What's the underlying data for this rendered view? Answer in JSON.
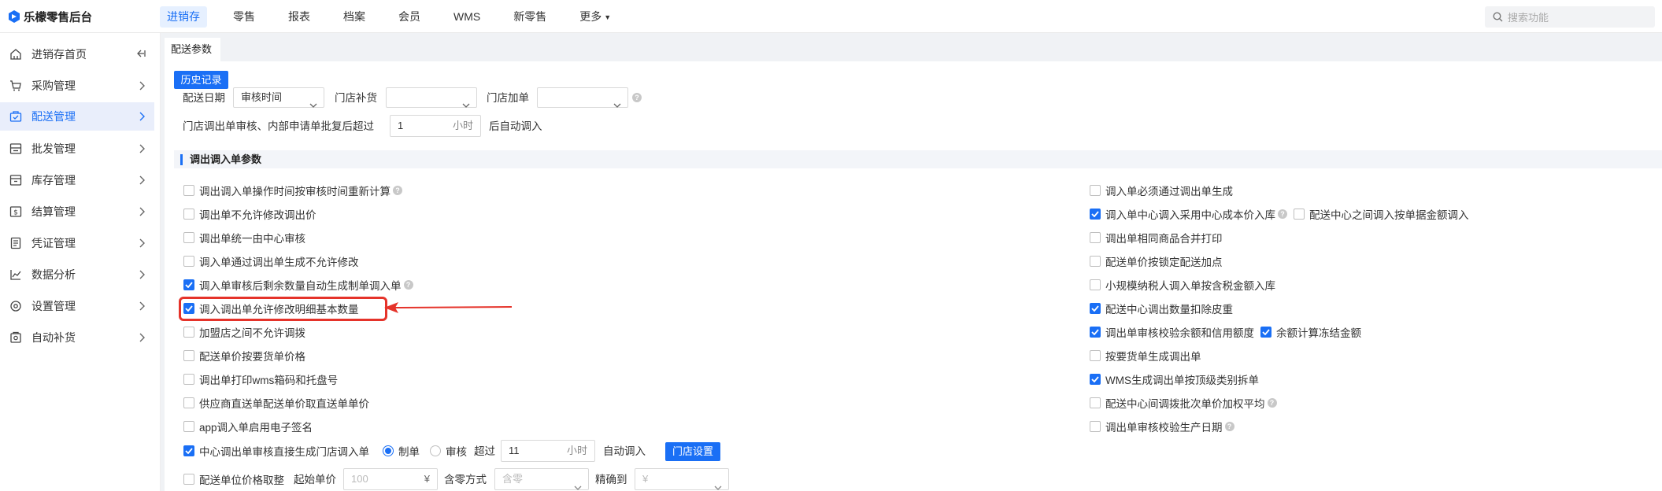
{
  "app": {
    "title": "乐檬零售后台"
  },
  "nav": {
    "items": [
      "进销存",
      "零售",
      "报表",
      "档案",
      "会员",
      "WMS",
      "新零售",
      "更多"
    ],
    "search_placeholder": "搜索功能"
  },
  "sidebar": {
    "items": [
      {
        "label": "进销存首页",
        "icon": "home-icon"
      },
      {
        "label": "采购管理",
        "icon": "cart-icon"
      },
      {
        "label": "配送管理",
        "icon": "delivery-icon"
      },
      {
        "label": "批发管理",
        "icon": "wholesale-icon"
      },
      {
        "label": "库存管理",
        "icon": "inventory-icon"
      },
      {
        "label": "结算管理",
        "icon": "settlement-icon"
      },
      {
        "label": "凭证管理",
        "icon": "voucher-icon"
      },
      {
        "label": "数据分析",
        "icon": "chart-icon"
      },
      {
        "label": "设置管理",
        "icon": "settings-icon"
      },
      {
        "label": "自动补货",
        "icon": "auto-replenish-icon"
      }
    ]
  },
  "page": {
    "tab": "配送参数",
    "history_button": "历史记录",
    "delivery_date_label": "配送日期",
    "delivery_date_value": "审核时间",
    "store_replenish_label": "门店补货",
    "store_replenish_value": "",
    "store_add_label": "门店加单",
    "store_add_value": "",
    "auto_in_prefix": "门店调出单审核、内部申请单批复后超过",
    "auto_in_value": "1",
    "auto_in_unit": "小时",
    "auto_in_suffix": "后自动调入",
    "section_title": "调出调入单参数"
  },
  "left_options": [
    {
      "label": "调出调入单操作时间按审核时间重新计算",
      "checked": false,
      "help": true
    },
    {
      "label": "调出单不允许修改调出价",
      "checked": false,
      "help": false
    },
    {
      "label": "调出单统一由中心审核",
      "checked": false,
      "help": false
    },
    {
      "label": "调入单通过调出单生成不允许修改",
      "checked": false,
      "help": false
    },
    {
      "label": "调入单审核后剩余数量自动生成制单调入单",
      "checked": true,
      "help": true
    },
    {
      "label": "调入调出单允许修改明细基本数量",
      "checked": true,
      "help": false
    },
    {
      "label": "加盟店之间不允许调拨",
      "checked": false,
      "help": false
    },
    {
      "label": "配送单价按要货单价格",
      "checked": false,
      "help": false
    },
    {
      "label": "调出单打印wms箱码和托盘号",
      "checked": false,
      "help": false
    },
    {
      "label": "供应商直送单配送单价取直送单单价",
      "checked": false,
      "help": false
    },
    {
      "label": "app调入单启用电子签名",
      "checked": false,
      "help": false
    }
  ],
  "center_row": {
    "label": "中心调出单审核直接生成门店调入单",
    "checked": true,
    "radio_1": "制单",
    "radio_2": "审核",
    "over_label": "超过",
    "hours_value": "11",
    "hours_unit": "小时",
    "auto_in_label": "自动调入",
    "store_settings_button": "门店设置"
  },
  "price_row": {
    "label": "配送单位价格取整",
    "checked": false,
    "start_price_label": "起始单价",
    "start_price_placeholder": "100",
    "start_price_unit": "¥",
    "rounding_label": "含零方式",
    "rounding_placeholder": "含零",
    "precision_label": "精确到",
    "precision_placeholder": "¥"
  },
  "right_options": [
    {
      "label": "调入单必须通过调出单生成",
      "checked": false,
      "help": false
    },
    {
      "label": "调入单中心调入采用中心成本价入库",
      "checked": true,
      "help": true,
      "extra": {
        "label": "配送中心之间调入按单据金额调入",
        "checked": false
      }
    },
    {
      "label": "调出单相同商品合并打印",
      "checked": false,
      "help": false
    },
    {
      "label": "配送单价按锁定配送加点",
      "checked": false,
      "help": false
    },
    {
      "label": "小规模纳税人调入单按含税金额入库",
      "checked": false,
      "help": false
    },
    {
      "label": "配送中心调出数量扣除皮重",
      "checked": true,
      "help": false
    },
    {
      "label": "调出单审核校验余额和信用额度",
      "checked": true,
      "help": false,
      "extra": {
        "label": "余额计算冻结金额",
        "checked": true
      }
    },
    {
      "label": "按要货单生成调出单",
      "checked": false,
      "help": false
    },
    {
      "label": "WMS生成调出单按顶级类别拆单",
      "checked": true,
      "help": false
    },
    {
      "label": "配送中心间调拨批次单价加权平均",
      "checked": false,
      "help": true
    },
    {
      "label": "调出单审核校验生产日期",
      "checked": false,
      "help": true
    }
  ],
  "colors": {
    "accent": "#1a6ff5",
    "highlight": "#e5332a"
  }
}
